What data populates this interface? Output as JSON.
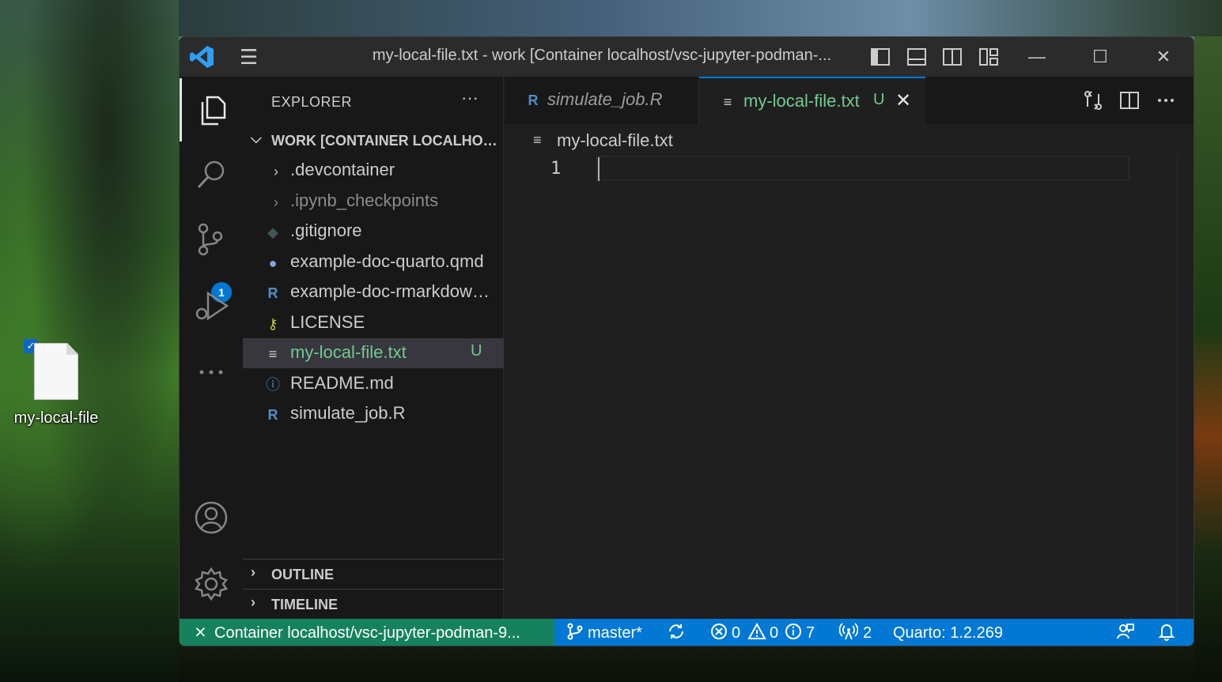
{
  "desktop": {
    "icon_label": "my-local-file"
  },
  "window": {
    "title": "my-local-file.txt - work [Container localhost/vsc-jupyter-podman-...",
    "minimize_glyph": "—",
    "maximize_glyph": "☐",
    "close_glyph": "✕"
  },
  "activity_bar": {
    "source_control_badge": "1"
  },
  "sidebar": {
    "header": "EXPLORER",
    "more": "···",
    "workspace_title": "WORK [CONTAINER LOCALHOST/VSC-JUPYTER-PODMAN-...]",
    "items": [
      {
        "label": ".devcontainer",
        "type": "folder"
      },
      {
        "label": ".ipynb_checkpoints",
        "type": "folder"
      },
      {
        "label": ".gitignore",
        "type": "file"
      },
      {
        "label": "example-doc-quarto.qmd",
        "type": "file"
      },
      {
        "label": "example-doc-rmarkdown.Rmd",
        "type": "file"
      },
      {
        "label": "LICENSE",
        "type": "file"
      },
      {
        "label": "my-local-file.txt",
        "type": "file",
        "status": "U"
      },
      {
        "label": "README.md",
        "type": "file"
      },
      {
        "label": "simulate_job.R",
        "type": "file"
      }
    ],
    "outline": "OUTLINE",
    "timeline": "TIMELINE"
  },
  "tabs": [
    {
      "label": "simulate_job.R"
    },
    {
      "label": "my-local-file.txt",
      "status": "U"
    }
  ],
  "breadcrumb": "my-local-file.txt",
  "editor": {
    "line_number": "1"
  },
  "statusbar": {
    "remote": "Container localhost/vsc-jupyter-podman-9...",
    "branch": "master*",
    "errors": "0",
    "warnings": "0",
    "info": "7",
    "ports": "2",
    "quarto": "Quarto: 1.2.269"
  },
  "colors": {
    "accent": "#0078d4",
    "remote_bg": "#16825d",
    "untracked_green": "#73c991"
  }
}
